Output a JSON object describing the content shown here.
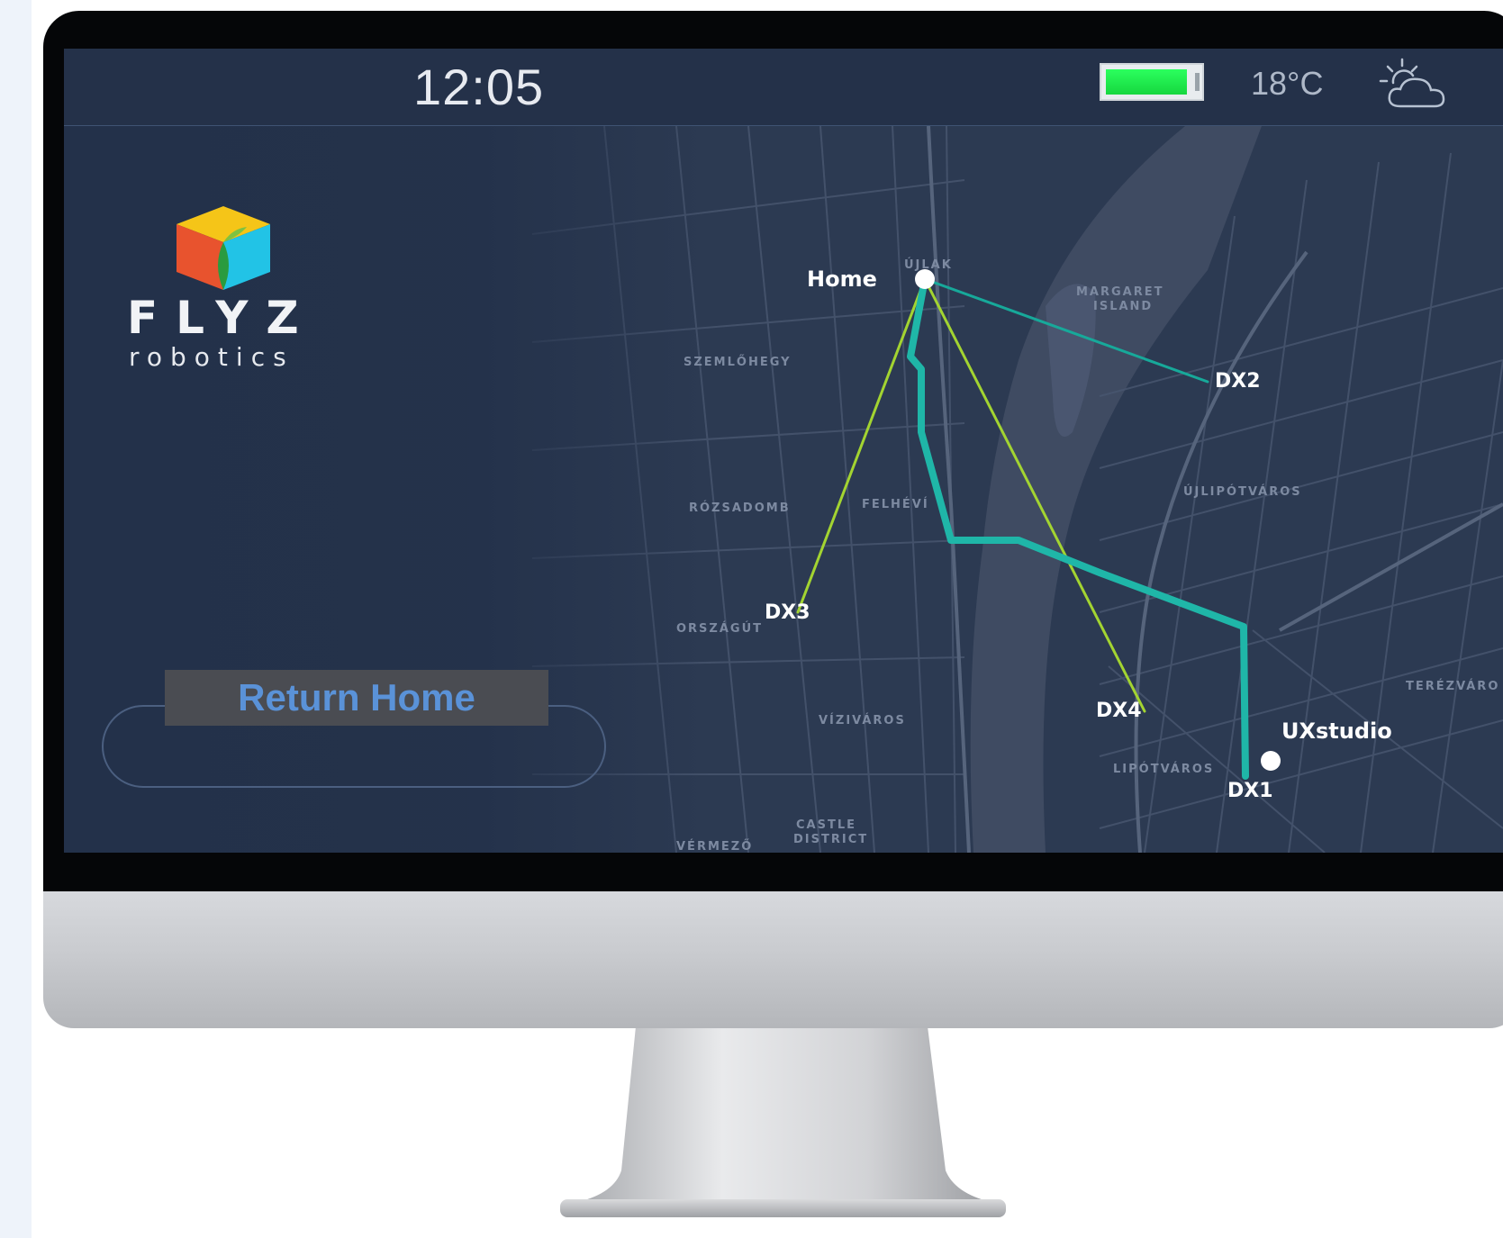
{
  "status_bar": {
    "time": "12:05",
    "battery_level": 0.88,
    "temperature": "18°C",
    "weather_icon": "partly-cloudy-icon"
  },
  "brand": {
    "name": "FLYZ",
    "subtitle": "robotics",
    "logo_icon": "cube-logo-icon",
    "colors": [
      "#f5c518",
      "#e8532e",
      "#22c3e6",
      "#2a9b3f"
    ]
  },
  "actions": {
    "return_home": "Return Home"
  },
  "map": {
    "route_color": "#1fb6a8",
    "path_color": "#a3d431",
    "link_color": "#17a99a",
    "locations": {
      "home": "Home",
      "dx1": "DX1",
      "dx2": "DX2",
      "dx3": "DX3",
      "dx4": "DX4",
      "uxstudio": "UXstudio"
    },
    "district_labels": {
      "ujlak": "ÚJLAK",
      "margaret_island": "MARGARET",
      "margaret_island_2": "ISLAND",
      "szemlohegy": "SZEMLŐHEGY",
      "rozsadomb": "RÓZSADOMB",
      "felhevi": "FELHÉVÍ",
      "ujlipotvaros": "ÚJLIPÓTVÁROS",
      "orszagut": "ORSZÁGÚT",
      "viziváros": "VÍZIVÁROS",
      "lipotvaros": "LIPÓTVÁROS",
      "castle_district": "CASTLE",
      "castle_district_2": "DISTRICT",
      "vermezo": "VÉRMEZŐ",
      "terezvaros": "TERÉZVÁRO"
    }
  }
}
